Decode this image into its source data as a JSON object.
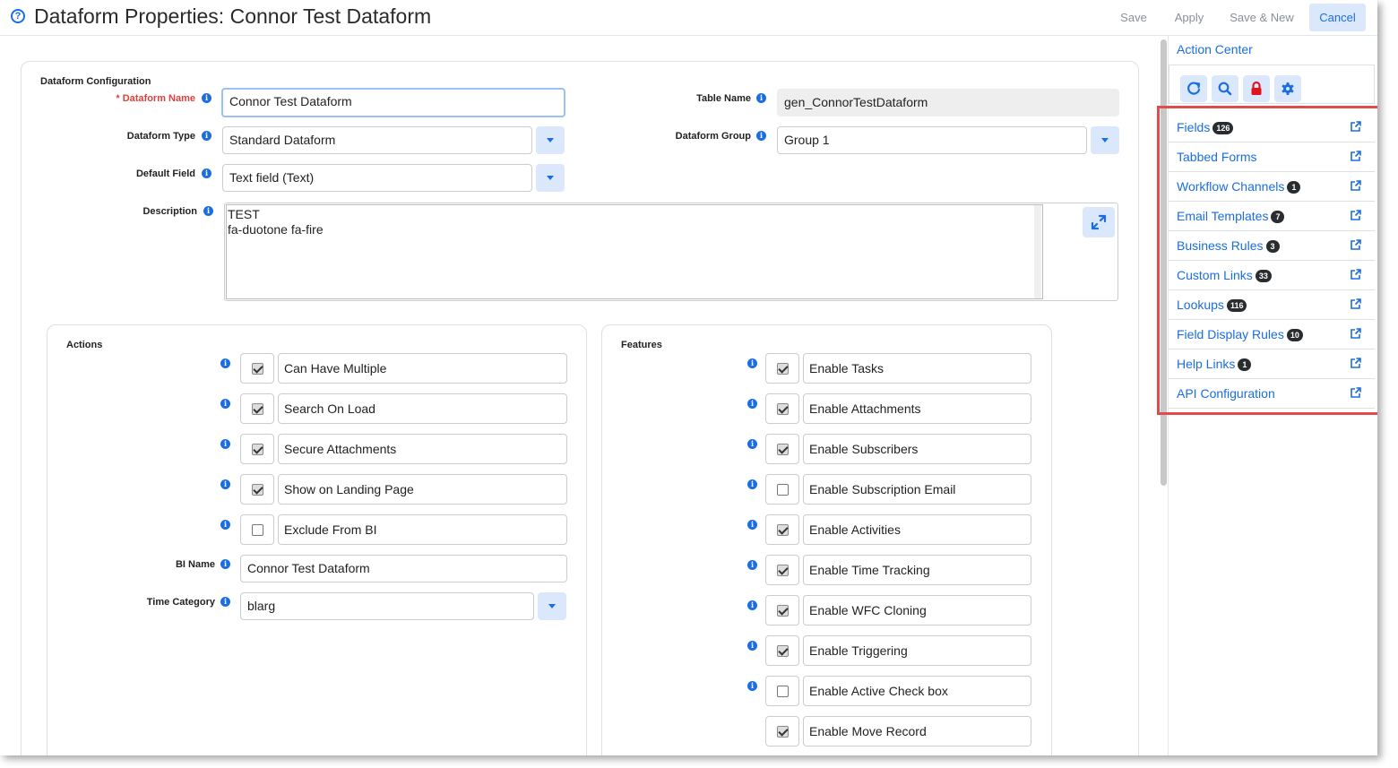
{
  "header": {
    "title": "Dataform Properties: Connor Test Dataform",
    "buttons": {
      "save": "Save",
      "apply": "Apply",
      "save_new": "Save & New",
      "cancel": "Cancel"
    }
  },
  "config": {
    "section_title": "Dataform Configuration",
    "dataform_name_label": "* Dataform Name",
    "dataform_name_value": "Connor Test Dataform",
    "table_name_label": "Table Name",
    "table_name_value": "gen_ConnorTestDataform",
    "dataform_type_label": "Dataform Type",
    "dataform_type_value": "Standard Dataform",
    "dataform_group_label": "Dataform Group",
    "dataform_group_value": "Group 1",
    "default_field_label": "Default Field",
    "default_field_value": "Text field (Text)",
    "description_label": "Description",
    "description_value": "TEST\nfa-duotone fa-fire"
  },
  "actions": {
    "title": "Actions",
    "items": [
      {
        "label": "Can Have Multiple",
        "checked": true
      },
      {
        "label": "Search On Load",
        "checked": true
      },
      {
        "label": "Secure Attachments",
        "checked": true
      },
      {
        "label": "Show on Landing Page",
        "checked": true
      },
      {
        "label": "Exclude From BI",
        "checked": false
      }
    ],
    "bi_name_label": "BI Name",
    "bi_name_value": "Connor Test Dataform",
    "time_category_label": "Time Category",
    "time_category_value": "blarg"
  },
  "features": {
    "title": "Features",
    "items": [
      {
        "label": "Enable Tasks",
        "checked": true
      },
      {
        "label": "Enable Attachments",
        "checked": true
      },
      {
        "label": "Enable Subscribers",
        "checked": true
      },
      {
        "label": "Enable Subscription Email",
        "checked": false
      },
      {
        "label": "Enable Activities",
        "checked": true
      },
      {
        "label": "Enable Time Tracking",
        "checked": true
      },
      {
        "label": "Enable WFC Cloning",
        "checked": true
      },
      {
        "label": "Enable Triggering",
        "checked": true
      },
      {
        "label": "Enable Active Check box",
        "checked": false
      },
      {
        "label": "Enable Move Record",
        "checked": true
      }
    ]
  },
  "action_center": {
    "title": "Action Center",
    "tools": [
      "refresh-icon",
      "search-icon",
      "lock-icon",
      "gear-icon"
    ],
    "items": [
      {
        "label": "Fields",
        "badge": "126"
      },
      {
        "label": "Tabbed Forms",
        "badge": ""
      },
      {
        "label": "Workflow Channels",
        "badge": "1"
      },
      {
        "label": "Email Templates",
        "badge": "7"
      },
      {
        "label": "Business Rules",
        "badge": "3"
      },
      {
        "label": "Custom Links",
        "badge": "33"
      },
      {
        "label": "Lookups",
        "badge": "116"
      },
      {
        "label": "Field Display Rules",
        "badge": "10"
      },
      {
        "label": "Help Links",
        "badge": "1"
      },
      {
        "label": "API Configuration",
        "badge": ""
      }
    ]
  },
  "colors": {
    "accent": "#1b6ee0",
    "highlight": "#e24b4b",
    "button_bg": "#dbe8fb",
    "required": "#e0403a"
  }
}
